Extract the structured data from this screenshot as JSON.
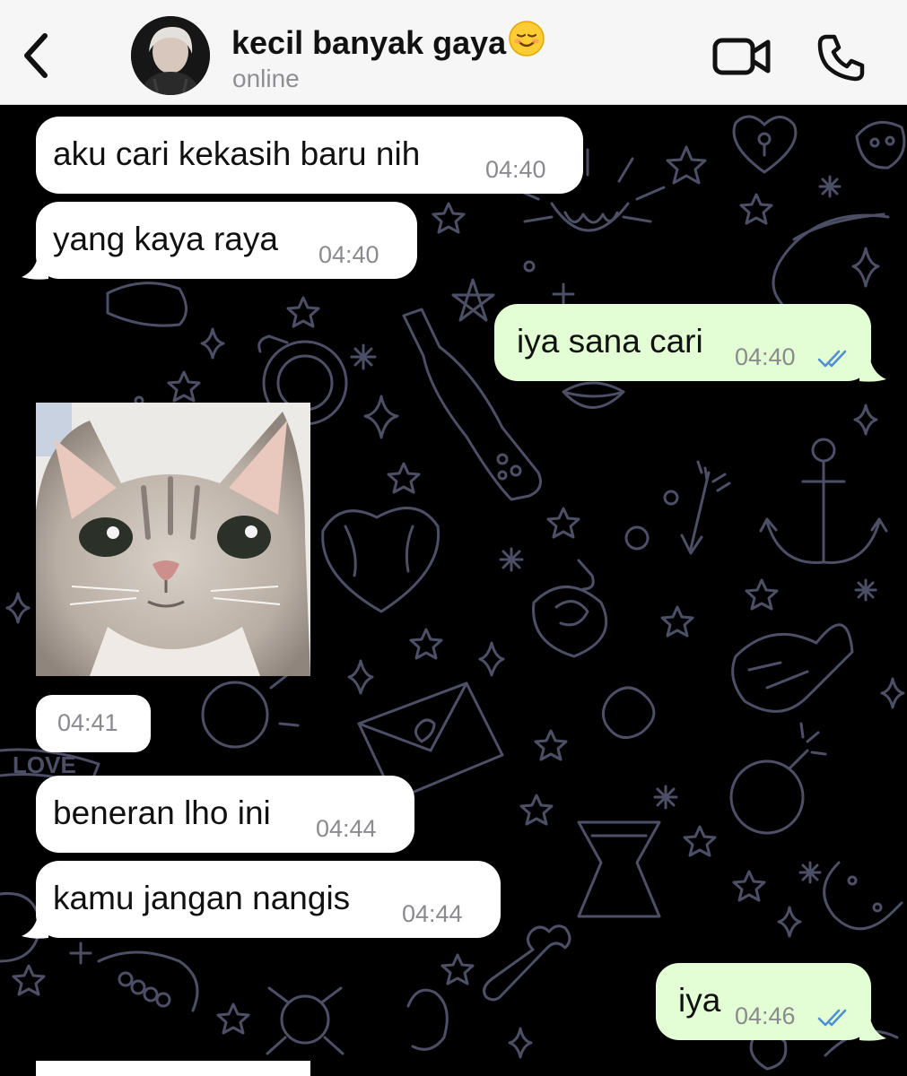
{
  "header": {
    "contact_name": "kecil banyak gaya",
    "status": "online"
  },
  "icons": {
    "back": "chevron-left-icon",
    "video": "video-camera-icon",
    "call": "phone-icon",
    "read": "double-check-icon",
    "name_emoji": "smiling-face-icon"
  },
  "colors": {
    "header_bg": "#f6f6f6",
    "incoming_bubble": "#ffffff",
    "outgoing_bubble": "#e3fdd4",
    "read_tick": "#4f8fd1",
    "wallpaper_bg": "#000000",
    "wallpaper_doodles": "#4d4f66"
  },
  "messages": [
    {
      "direction": "in",
      "text": "aku cari kekasih baru nih",
      "time": "04:40"
    },
    {
      "direction": "in",
      "text": "yang kaya raya",
      "time": "04:40"
    },
    {
      "direction": "out",
      "text": "iya sana cari",
      "time": "04:40",
      "read": true
    },
    {
      "direction": "in",
      "type": "image",
      "image": "gray-kitten-photo",
      "time": "04:41"
    },
    {
      "direction": "in",
      "text": "beneran lho ini",
      "time": "04:44"
    },
    {
      "direction": "in",
      "text": "kamu jangan nangis",
      "time": "04:44"
    },
    {
      "direction": "out",
      "text": "iya",
      "time": "04:46",
      "read": true
    }
  ]
}
